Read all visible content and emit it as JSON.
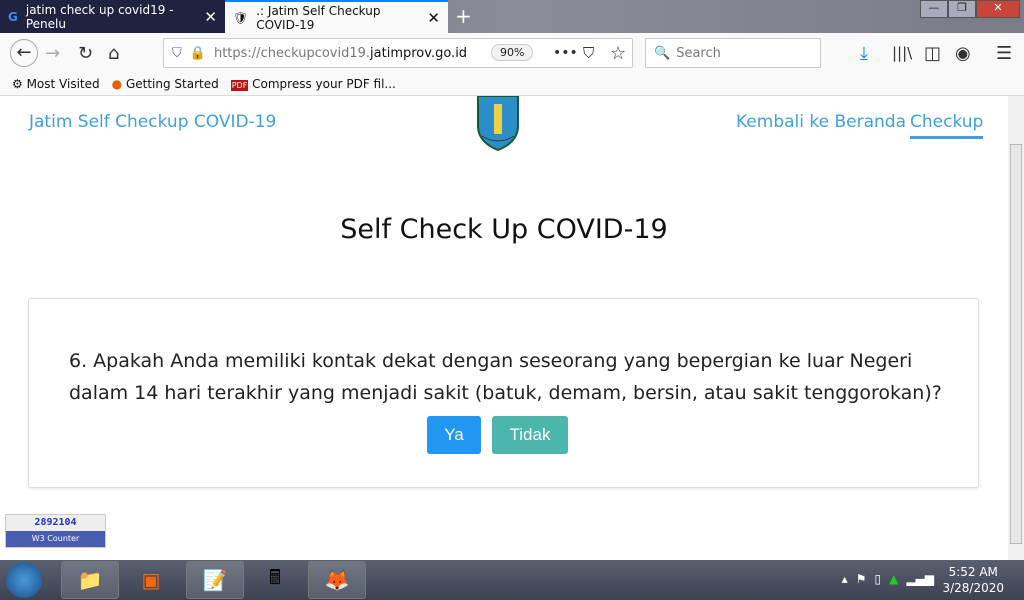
{
  "browser": {
    "tabs": [
      {
        "title": "jatim check up covid19 - Penelu"
      },
      {
        "title": ".: Jatim Self Checkup COVID-19"
      }
    ],
    "url_prefix": "https://checkupcovid19.",
    "url_domain": "jatimprov.go.id",
    "zoom": "90%",
    "search_placeholder": "Search",
    "bookmarks": [
      "Most Visited",
      "Getting Started",
      "Compress your PDF fil..."
    ]
  },
  "site": {
    "brand": "Jatim Self Checkup COVID-19",
    "nav": [
      "Kembali ke Beranda",
      "Checkup"
    ],
    "title": "Self Check Up COVID-19",
    "question": "6. Apakah Anda memiliki kontak dekat dengan seseorang yang bepergian ke luar Negeri dalam 14 hari terakhir yang menjadi sakit (batuk, demam, bersin, atau sakit tenggorokan)?",
    "yes": "Ya",
    "no": "Tidak",
    "counter_value": "2892104",
    "counter_label": "W3 Counter"
  },
  "taskbar": {
    "time": "5:52 AM",
    "date": "3/28/2020"
  }
}
